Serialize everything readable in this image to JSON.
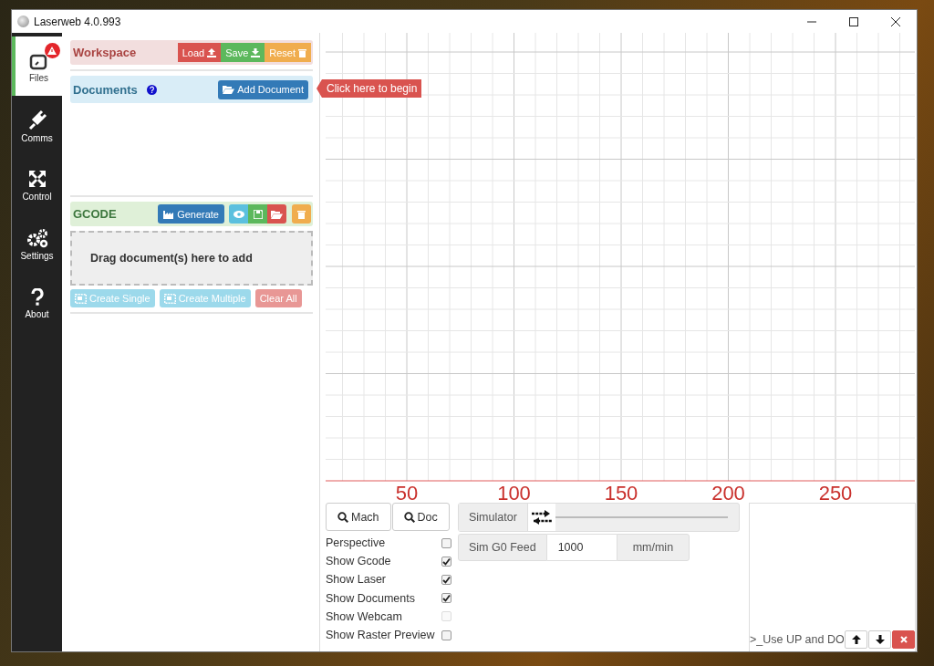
{
  "window": {
    "title": "Laserweb 4.0.993"
  },
  "nav": [
    {
      "label": "Files",
      "selected": true,
      "alert": true
    },
    {
      "label": "Comms",
      "selected": false,
      "alert": false
    },
    {
      "label": "Control",
      "selected": false,
      "alert": false
    },
    {
      "label": "Settings",
      "selected": false,
      "alert": false
    },
    {
      "label": "About",
      "selected": false,
      "alert": false
    }
  ],
  "workspace": {
    "title": "Workspace",
    "buttons": [
      {
        "label": "Load"
      },
      {
        "label": "Save"
      },
      {
        "label": "Reset"
      }
    ]
  },
  "documents": {
    "title": "Documents",
    "add_button": "Add Document",
    "tooltip": "Click here to begin"
  },
  "gcode": {
    "title": "GCODE",
    "generate_button": "Generate",
    "drop_zone": "Drag document(s) here to add",
    "actions": [
      {
        "label": "Create Single",
        "disabled": true
      },
      {
        "label": "Create Multiple",
        "disabled": true
      },
      {
        "label": "Clear All",
        "disabled": true
      }
    ]
  },
  "ruler_labels": [
    "50",
    "100",
    "150",
    "200",
    "250"
  ],
  "view_buttons": [
    "Mach",
    "Doc"
  ],
  "options": [
    {
      "label": "Perspective",
      "checked": false,
      "disabled": false
    },
    {
      "label": "Show Gcode",
      "checked": true,
      "disabled": false
    },
    {
      "label": "Show Laser",
      "checked": true,
      "disabled": false
    },
    {
      "label": "Show Documents",
      "checked": true,
      "disabled": false
    },
    {
      "label": "Show Webcam",
      "checked": false,
      "disabled": true
    },
    {
      "label": "Show Raster Preview",
      "checked": false,
      "disabled": false
    }
  ],
  "simulator": {
    "label": "Simulator",
    "level": 0
  },
  "feed": {
    "label": "Sim G0 Feed",
    "value": "1000",
    "unit": "mm/min"
  },
  "console": {
    "prompt": ">_Use UP and DO"
  }
}
